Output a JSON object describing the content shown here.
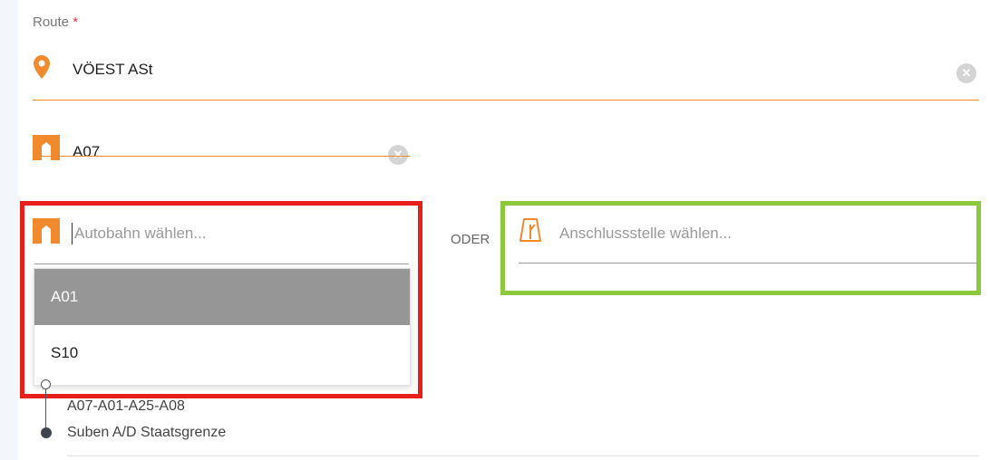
{
  "route": {
    "label": "Route",
    "required_marker": "*",
    "from": "VÖEST ASt",
    "segment": "A07"
  },
  "autobahn_select": {
    "placeholder": "Autobahn wählen...",
    "options": [
      "A01",
      "S10"
    ],
    "highlighted": "A01"
  },
  "separator": "ODER",
  "anschlussstelle_select": {
    "placeholder": "Anschlussstelle wählen..."
  },
  "route_summary": {
    "start": "VÖEST ASt",
    "via": "A07-A01-A25-A08",
    "end": "Suben A/D Staatsgrenze"
  },
  "colors": {
    "accent": "#f08a2c",
    "highlight_red": "#e8201c",
    "highlight_green": "#8cc83c",
    "selected_option_bg": "#969696"
  },
  "icons": [
    "location-pin-icon",
    "clear-icon",
    "highway-icon",
    "junction-icon"
  ]
}
